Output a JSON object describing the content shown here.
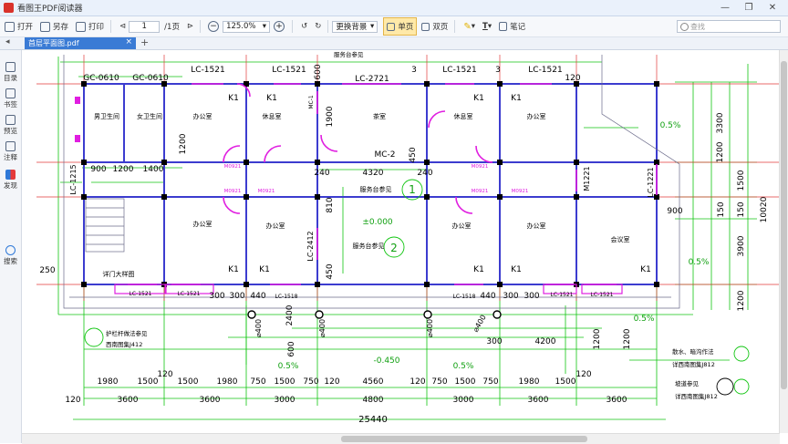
{
  "window": {
    "title": "看图王PDF阅读器"
  },
  "toolbar": {
    "open": "打开",
    "save_as": "另存",
    "print": "打印",
    "page_current": "1",
    "page_total": "/1页",
    "zoom": "125.0%",
    "replace_bg": "更换背景",
    "single_page": "单页",
    "double_page": "双页",
    "note": "笔记"
  },
  "search": {
    "placeholder": "查找"
  },
  "tabs": {
    "doc_name": "首层平面图.pdf"
  },
  "sidebar": {
    "items": [
      "目录",
      "书签",
      "预览",
      "注释",
      "发现",
      "搜索"
    ]
  },
  "drawing": {
    "windows": [
      "GC-0610",
      "GC-0610",
      "LC-1521",
      "LC-1521",
      "LC-2721",
      "LC-1521",
      "LC-1521",
      "LC-1521",
      "LC-1521",
      "LC-1518",
      "LC-1518",
      "LC-1521",
      "LC-1521"
    ],
    "walls_v": [
      "LC-1215",
      "LC-2412",
      "M1221",
      "LC-1221",
      "MC-1"
    ],
    "rooms": {
      "men_toilet": "男卫生间",
      "women_toilet": "女卫生间",
      "office": "办公室",
      "lounge": "休息室",
      "tea": "茶室",
      "service": "服务台参见",
      "meeting": "会议室",
      "porch": "详门大样图"
    },
    "door_marks": [
      "K1",
      "M0921",
      "MC-2"
    ],
    "top_dims": [
      "600",
      "3",
      "3",
      "120"
    ],
    "mid_dims": [
      "900",
      "1200",
      "1400",
      "240",
      "4320",
      "240",
      "1200",
      "1900",
      "450",
      "810",
      "450",
      "150"
    ],
    "bottom_row1": [
      "1980",
      "1500",
      "120",
      "1500",
      "1980",
      "750",
      "1500",
      "750",
      "120",
      "4560",
      "120",
      "750",
      "1500",
      "750",
      "1980",
      "1500",
      "120"
    ],
    "bottom_row2": [
      "120",
      "3600",
      "3600",
      "3000",
      "4800",
      "3000",
      "3600",
      "3600"
    ],
    "total": "25440",
    "right_dims": [
      "3300",
      "1200",
      "1500",
      "150",
      "3900",
      "1200",
      "10020"
    ],
    "col_dims": [
      "300",
      "300",
      "440",
      "440",
      "300",
      "300",
      "2400",
      "600",
      "300",
      "4200",
      "1200",
      "1200",
      "250",
      "900"
    ],
    "diameters": [
      "⌀400",
      "⌀400",
      "⌀400",
      "⌀400"
    ],
    "levels": [
      "±0.000",
      "-0.450",
      "0.5%"
    ],
    "notes": {
      "railing": "护栏杆做法参见",
      "atlas1": "西南图集J412",
      "scatter": "散水、暗沟作法",
      "atlas2": "详西南图集J812",
      "slope": "坡道参见",
      "atlas3": "详西南图集J812",
      "sign": "服务台参见"
    },
    "axes": [
      "1",
      "2"
    ]
  }
}
